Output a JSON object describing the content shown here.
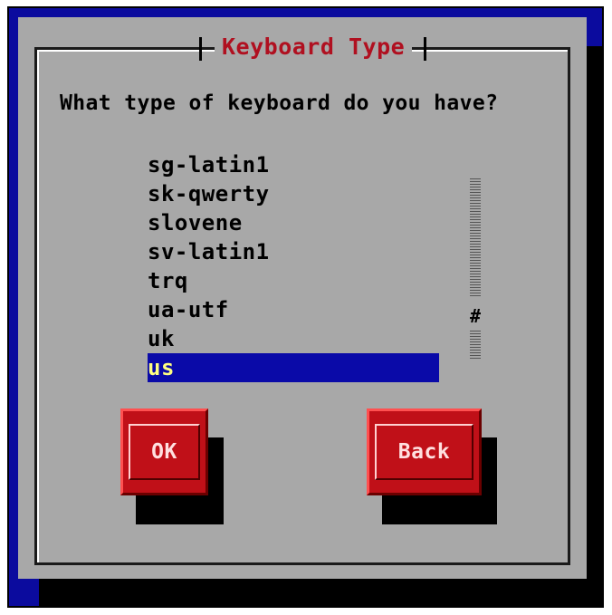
{
  "dialog": {
    "title": "Keyboard Type",
    "prompt": "What type of keyboard do you have?"
  },
  "keyboard_list": {
    "items": [
      "sg-latin1",
      "sk-qwerty",
      "slovene",
      "sv-latin1",
      "trq",
      "ua-utf",
      "uk",
      "us"
    ],
    "selected": "us"
  },
  "scrollbar": {
    "thumb_glyph": "#"
  },
  "buttons": {
    "ok_label": "OK",
    "back_label": "Back"
  },
  "colors": {
    "background": "#0b0b9e",
    "dialog": "#a8a8a8",
    "title": "#b01020",
    "selection": "#0a0aa8",
    "button": "#c01018"
  }
}
